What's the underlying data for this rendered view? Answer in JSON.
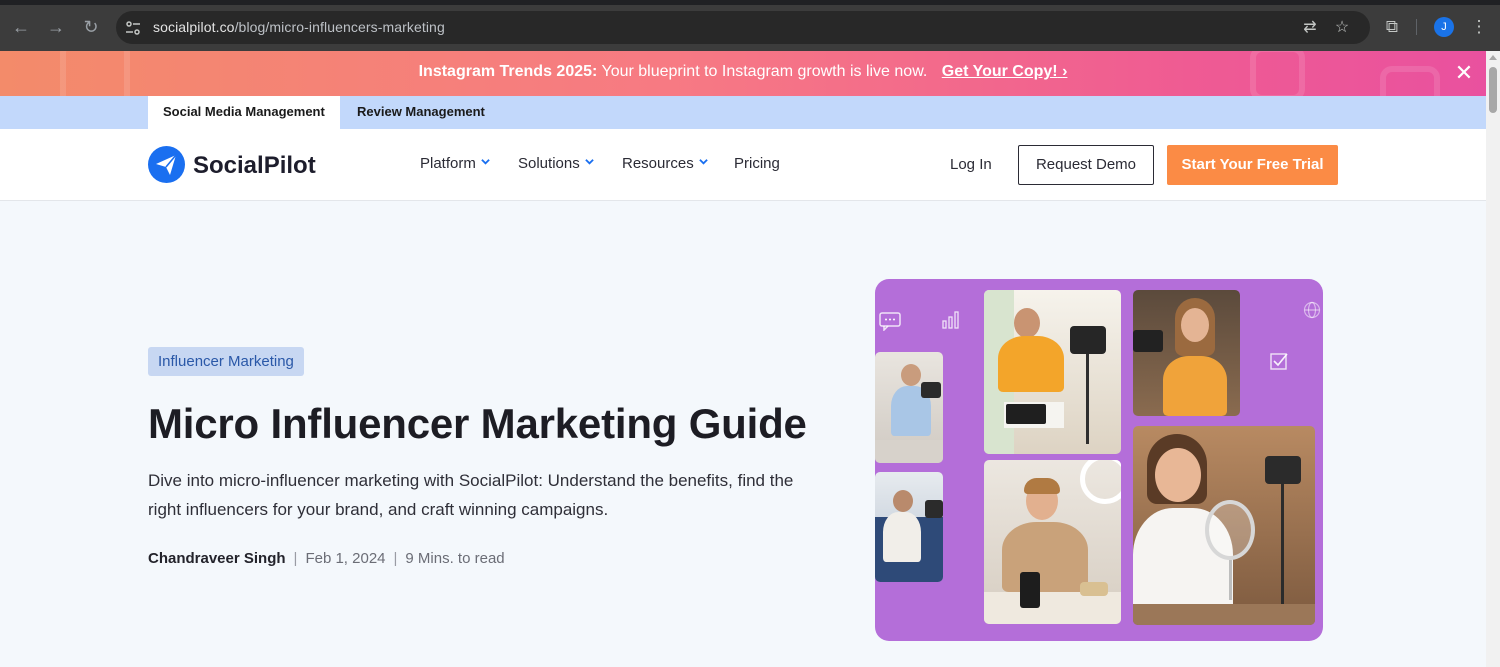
{
  "browser": {
    "url_host": "socialpilot.co",
    "url_path": "/blog/micro-influencers-marketing",
    "profile_initial": "J"
  },
  "promo": {
    "bold": "Instagram Trends 2025:",
    "text": " Your blueprint to Instagram growth is live now.",
    "cta": "Get Your Copy!",
    "cta_arrow": "›"
  },
  "switchbar": {
    "tabs": [
      {
        "label": "Social Media Management",
        "active": true
      },
      {
        "label": "Review Management",
        "active": false
      }
    ]
  },
  "header": {
    "logo": "SocialPilot",
    "menu": [
      {
        "label": "Platform",
        "dropdown": true
      },
      {
        "label": "Solutions",
        "dropdown": true
      },
      {
        "label": "Resources",
        "dropdown": true
      },
      {
        "label": "Pricing",
        "dropdown": false
      }
    ],
    "login": "Log In",
    "demo": "Request Demo",
    "trial": "Start Your Free Trial"
  },
  "hero": {
    "tag": "Influencer Marketing",
    "title": "Micro Influencer Marketing Guide",
    "description": "Dive into micro-influencer marketing with SocialPilot: Understand the benefits, find the right influencers for your brand, and craft winning campaigns.",
    "author": "Chandraveer Singh",
    "date": "Feb 1, 2024",
    "read_time": "9 Mins. to read",
    "separator": "|"
  },
  "colors": {
    "accent_orange": "#fb8b45",
    "brand_blue": "#1a73e8",
    "hero_purple": "#b46ed9"
  }
}
